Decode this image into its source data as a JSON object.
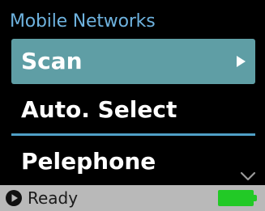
{
  "menu": {
    "title": "Mobile Networks",
    "items": [
      {
        "label": "Scan",
        "selected": true,
        "icon": "arrow-right-icon"
      },
      {
        "label": "Auto. Select",
        "selected": false
      },
      {
        "label": "Pelephone",
        "selected": false
      }
    ],
    "more_indicator": "chevron-down-icon"
  },
  "status": {
    "text": "Ready",
    "icon": "play-circle-icon",
    "battery_level": 1.0,
    "battery_color": "#22c926"
  },
  "colors": {
    "title": "#6eb2de",
    "selected_bg": "#5f9ea5",
    "divider": "#4f9fc6",
    "status_bar_bg": "#b9b9b9"
  }
}
